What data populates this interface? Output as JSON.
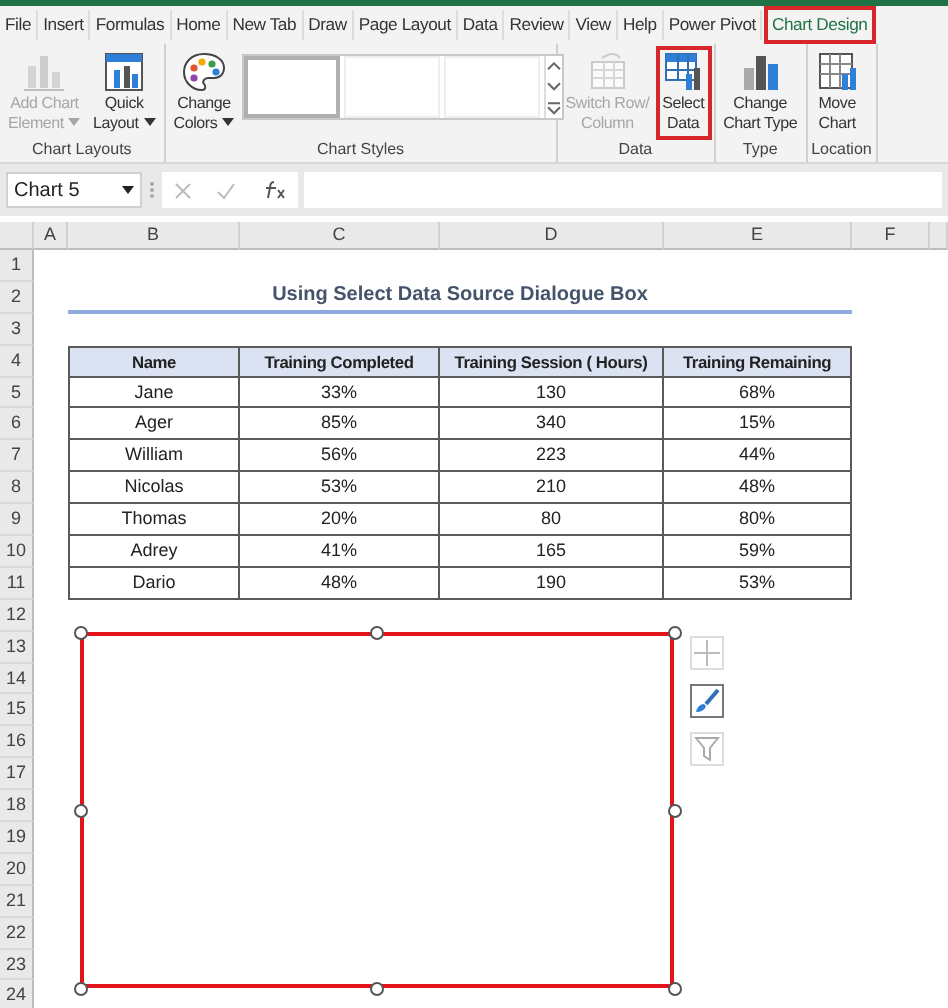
{
  "tabs": [
    {
      "label": "File",
      "selected": false,
      "highlighted": false
    },
    {
      "label": "Insert",
      "selected": false,
      "highlighted": false
    },
    {
      "label": "Formulas",
      "selected": false,
      "highlighted": false
    },
    {
      "label": "Home",
      "selected": false,
      "highlighted": false
    },
    {
      "label": "New Tab",
      "selected": false,
      "highlighted": false
    },
    {
      "label": "Draw",
      "selected": false,
      "highlighted": false
    },
    {
      "label": "Page Layout",
      "selected": false,
      "highlighted": false
    },
    {
      "label": "Data",
      "selected": false,
      "highlighted": false
    },
    {
      "label": "Review",
      "selected": false,
      "highlighted": false
    },
    {
      "label": "View",
      "selected": false,
      "highlighted": false
    },
    {
      "label": "Help",
      "selected": false,
      "highlighted": false
    },
    {
      "label": "Power Pivot",
      "selected": false,
      "highlighted": false
    },
    {
      "label": "Chart Design",
      "selected": true,
      "highlighted": true
    }
  ],
  "ribbon": [
    {
      "label": "Chart Layouts",
      "items": [
        {
          "kind": "addelement",
          "lines": [
            "Add Chart",
            "Element"
          ],
          "dropdown": true,
          "disabled": true,
          "highlighted": false
        },
        {
          "kind": "layout",
          "lines": [
            "Quick",
            "Layout"
          ],
          "dropdown": true,
          "disabled": false,
          "highlighted": false
        }
      ]
    },
    {
      "label": "Chart Styles",
      "items": [
        {
          "kind": "colors",
          "lines": [
            "Change",
            "Colors"
          ],
          "dropdown": true,
          "disabled": false,
          "highlighted": false
        },
        {
          "kind": "gallery",
          "styles": [
            {
              "selected": true
            },
            {
              "selected": false
            },
            {
              "selected": false
            }
          ]
        }
      ]
    },
    {
      "label": "Data",
      "items": [
        {
          "kind": "switch",
          "lines": [
            "Switch Row/",
            "Column"
          ],
          "dropdown": false,
          "disabled": true,
          "highlighted": false
        },
        {
          "kind": "select",
          "lines": [
            "Select",
            "Data"
          ],
          "dropdown": false,
          "disabled": false,
          "highlighted": true
        }
      ]
    },
    {
      "label": "Type",
      "items": [
        {
          "kind": "charttype",
          "lines": [
            "Change",
            "Chart Type"
          ],
          "dropdown": false,
          "disabled": false,
          "highlighted": false
        }
      ]
    },
    {
      "label": "Location",
      "items": [
        {
          "kind": "move",
          "lines": [
            "Move",
            "Chart"
          ],
          "dropdown": false,
          "disabled": false,
          "highlighted": false
        }
      ]
    }
  ],
  "formula_bar": {
    "name_box": "Chart 5"
  },
  "sheet": {
    "columns": [
      "A",
      "B",
      "C",
      "D",
      "E",
      "F"
    ],
    "rows": [
      "1",
      "2",
      "3",
      "4",
      "5",
      "6",
      "7",
      "8",
      "9",
      "10",
      "11",
      "12",
      "13",
      "14",
      "15",
      "16",
      "17",
      "18",
      "19",
      "20",
      "21",
      "22",
      "23",
      "24"
    ],
    "title": "Using Select Data Source Dialogue Box",
    "table": {
      "columns": [
        "Name",
        "Training Completed",
        "Training Session ( Hours)",
        "Training Remaining"
      ],
      "rows": [
        [
          "Jane",
          "33%",
          "130",
          "68%"
        ],
        [
          "Ager",
          "85%",
          "340",
          "15%"
        ],
        [
          "William",
          "56%",
          "223",
          "44%"
        ],
        [
          "Nicolas",
          "53%",
          "210",
          "48%"
        ],
        [
          "Thomas",
          "20%",
          "80",
          "80%"
        ],
        [
          "Adrey",
          "41%",
          "165",
          "59%"
        ],
        [
          "Dario",
          "48%",
          "190",
          "53%"
        ]
      ]
    }
  },
  "chart": {
    "selected": true,
    "tools": [
      {
        "kind": "elements",
        "selected": false
      },
      {
        "kind": "styles",
        "selected": true
      },
      {
        "kind": "filter",
        "selected": false
      }
    ]
  }
}
